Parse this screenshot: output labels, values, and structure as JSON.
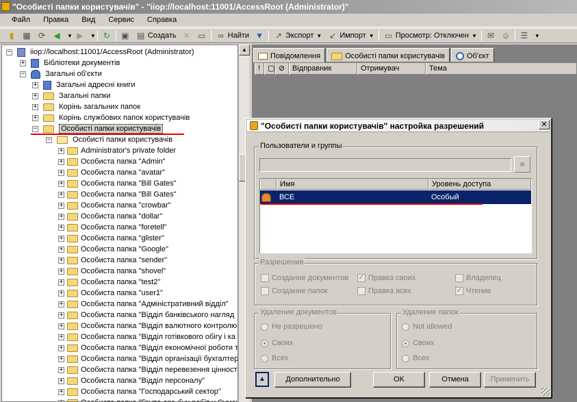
{
  "window": {
    "title": "\"Особисті папки користувачів\" - \"iiop://localhost:11001/AccessRoot (Administrator)\""
  },
  "menu": [
    "Файл",
    "Правка",
    "Вид",
    "Сервис",
    "Справка"
  ],
  "toolbar": {
    "create": "Создать",
    "find": "Найти",
    "export": "Экспорт",
    "import": "Импорт",
    "view": "Просмотр: Отключен"
  },
  "tree": {
    "root": "iiop://localhost:11001/AccessRoot (Administrator)",
    "libraries": "Бібліотеки документів",
    "shared": "Загальні об'єкти",
    "children": [
      "Загальні адресні книги",
      "Загальні папки",
      "Корінь загальних папок",
      "Корінь службових папок користувачів",
      "Особисті папки користувачів"
    ],
    "personal_root": "Особисті папки користувачів",
    "personal_folders": [
      "Administrator's private folder",
      "Особиста папка \"Admin\"",
      "Особиста папка \"avatar\"",
      "Особиста папка \"Bill Gates\"",
      "Особиста папка \"Bill Gates\"",
      "Особиста папка \"crowbar\"",
      "Особиста папка \"dollar\"",
      "Особиста папка \"foretell\"",
      "Особиста папка \"glister\"",
      "Особиста папка \"Google\"",
      "Особиста папка \"sender\"",
      "Особиста папка \"shovel\"",
      "Особиста папка \"test2\"",
      "Особиста папка \"user1\"",
      "Особиста папка \"Адміністративний відділ\"",
      "Особиста папка \"Відділ банківського нагляд",
      "Особиста папка \"Відділ валютного контролю",
      "Особиста папка \"Відділ готівкового обігу і ка",
      "Особиста папка \"Відділ економічної роботи т",
      "Особиста папка \"Відділ організації бухгалтер",
      "Особиста папка \"Відділ перевезення цінносте",
      "Особиста папка \"Відділ персоналу\"",
      "Особиста папка \"Господарський сектор\"",
      "Особиста папка \"Група орг.-бух.робіт у Сумсь"
    ]
  },
  "tabs": [
    "Повідомлення",
    "Особисті папки користувачів",
    "Об'єкт"
  ],
  "grid": {
    "columns": [
      "!",
      "",
      "",
      "Відправник",
      "Отримувач",
      "Тема"
    ]
  },
  "dialog": {
    "title": "\"Особисті папки користувачів\" настройка разрешений",
    "users_group": "Пользователи и группы",
    "acl_columns": [
      "Имя",
      "Уровень доступа"
    ],
    "acl_rows": [
      {
        "name": "ВСЕ",
        "level": "Особый"
      }
    ],
    "permissions_group": "Разрешения",
    "permissions": [
      {
        "label": "Создание документов",
        "checked": false
      },
      {
        "label": "Правка своих",
        "checked": true
      },
      {
        "label": "Владелец",
        "checked": false
      },
      {
        "label": "Создание папок",
        "checked": false
      },
      {
        "label": "Правка всех",
        "checked": false
      },
      {
        "label": "Чтение",
        "checked": true
      }
    ],
    "delete_docs_group": "Удаление документов",
    "delete_docs_options": [
      "Не разрешено",
      "Своих",
      "Всех"
    ],
    "delete_docs_selected": 1,
    "delete_folders_group": "Удаление папок",
    "delete_folders_options": [
      "Not allowed",
      "Своих",
      "Всех"
    ],
    "delete_folders_selected": 1,
    "buttons": {
      "more": "Дополнительно",
      "ok": "OK",
      "cancel": "Отмена",
      "apply": "Применить"
    }
  },
  "colors": {
    "selection": "#0a246a",
    "annotation": "#e00000"
  }
}
